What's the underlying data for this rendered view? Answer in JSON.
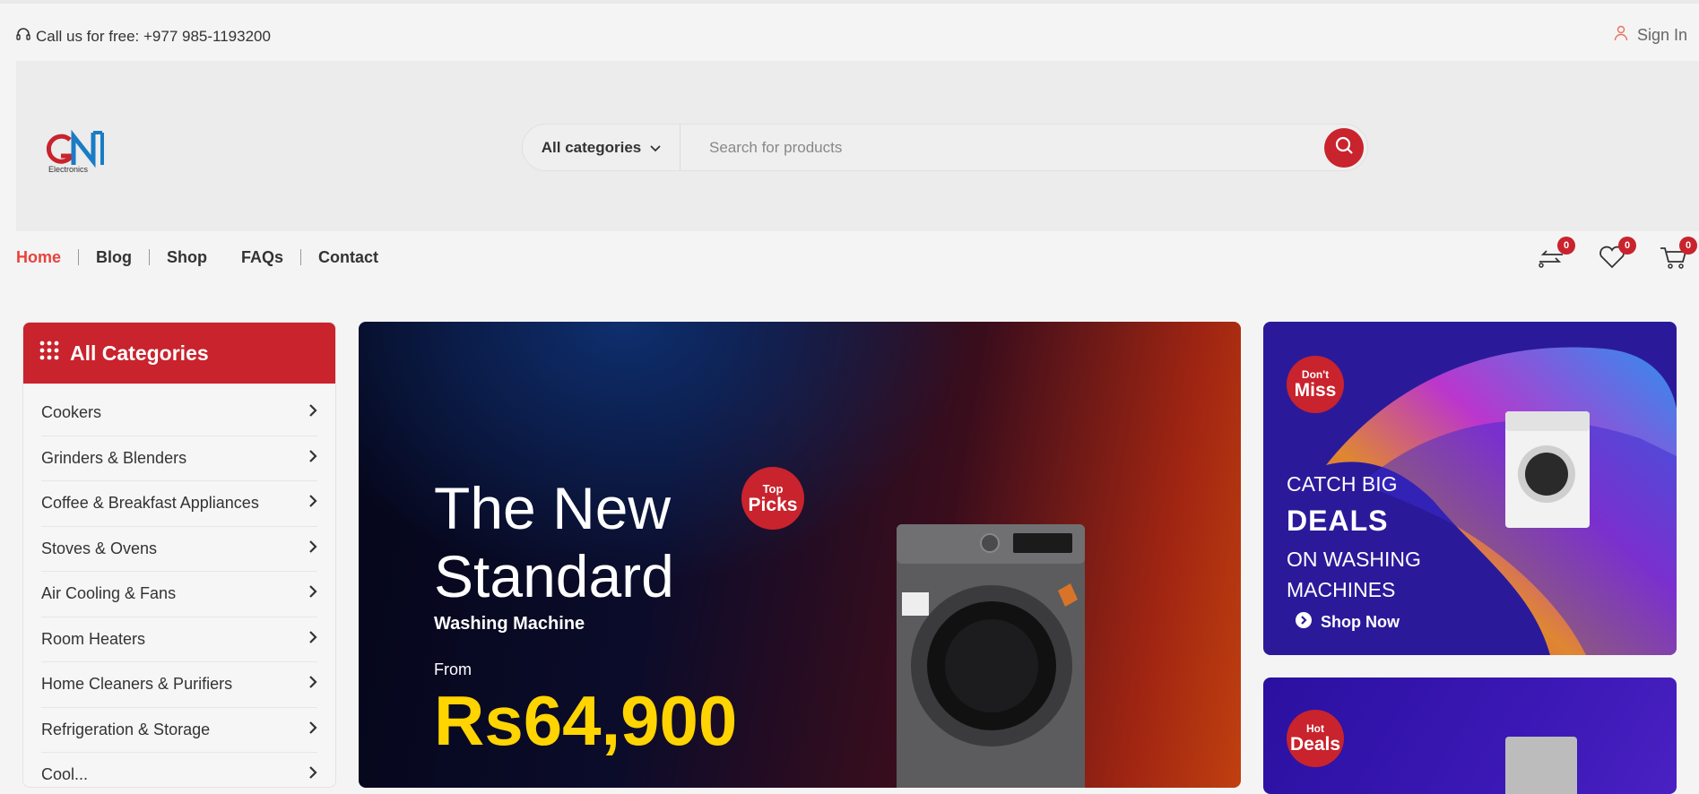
{
  "topbar": {
    "call_text": "Call us for free: +977 985-1193200",
    "signin_label": "Sign In"
  },
  "logo": {
    "mark": "GN",
    "sub": "Electronics"
  },
  "search": {
    "category_label": "All categories",
    "placeholder": "Search for products"
  },
  "nav": {
    "items": [
      {
        "label": "Home"
      },
      {
        "label": "Blog"
      },
      {
        "label": "Shop"
      },
      {
        "label": "FAQs"
      },
      {
        "label": "Contact"
      }
    ],
    "compare_count": "0",
    "wishlist_count": "0",
    "cart_count": "0"
  },
  "sidebar": {
    "title": "All Categories",
    "items": [
      {
        "label": "Cookers"
      },
      {
        "label": "Grinders & Blenders"
      },
      {
        "label": "Coffee & Breakfast Appliances"
      },
      {
        "label": "Stoves & Ovens"
      },
      {
        "label": "Air Cooling & Fans"
      },
      {
        "label": "Room Heaters"
      },
      {
        "label": "Home Cleaners & Purifiers"
      },
      {
        "label": "Refrigeration & Storage"
      },
      {
        "label": "Cool..."
      }
    ]
  },
  "hero": {
    "title_line1": "The New",
    "title_line2": "Standard",
    "subtitle": "Washing Machine",
    "from": "From",
    "price": "Rs64,900",
    "badge_small": "Top",
    "badge_big": "Picks"
  },
  "banner1": {
    "badge_small": "Don't",
    "badge_big": "Miss",
    "line1": "CATCH BIG",
    "line2": "DEALS",
    "line3": "ON WASHING",
    "line4": "MACHINES",
    "cta": "Shop Now"
  },
  "banner2": {
    "badge_small": "Hot",
    "badge_big": "Deals"
  },
  "colors": {
    "brand_red": "#c9232d",
    "nav_active": "#e8423c",
    "price_yellow": "#ffd400"
  }
}
